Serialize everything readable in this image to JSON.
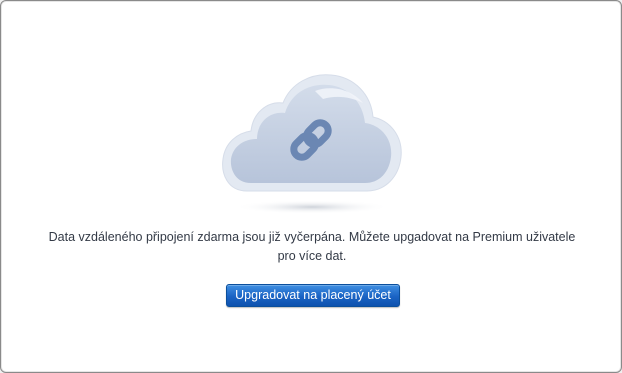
{
  "dialog": {
    "illustration_icon": "cloud-link-icon",
    "message": "Data vzdáleného připojení zdarma jsou již vyčerpána. Můžete upgadovat na Premium uživatele pro více dat.",
    "upgrade_button_label": "Upgradovat na placený účet"
  },
  "colors": {
    "accent": "#1a63c4",
    "cloud_fill": "#bfcbe0",
    "cloud_outline": "#dde4ef",
    "link_icon": "#6a86b2",
    "text": "#333a46"
  }
}
